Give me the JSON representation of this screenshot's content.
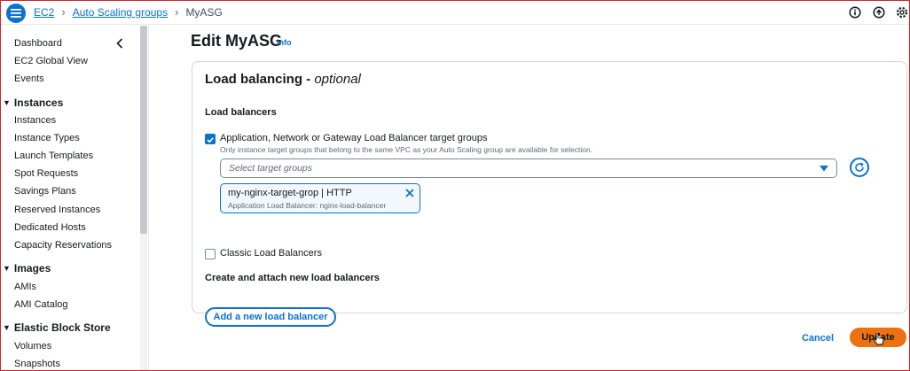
{
  "breadcrumb": {
    "items": [
      "EC2",
      "Auto Scaling groups"
    ],
    "current": "MyASG"
  },
  "topbar": {
    "icons": [
      "info-icon",
      "notifications-icon",
      "settings-icon"
    ]
  },
  "sidebar": {
    "top_items": [
      "Dashboard",
      "EC2 Global View",
      "Events"
    ],
    "sections": [
      {
        "title": "Instances",
        "items": [
          "Instances",
          "Instance Types",
          "Launch Templates",
          "Spot Requests",
          "Savings Plans",
          "Reserved Instances",
          "Dedicated Hosts",
          "Capacity Reservations"
        ]
      },
      {
        "title": "Images",
        "items": [
          "AMIs",
          "AMI Catalog"
        ]
      },
      {
        "title": "Elastic Block Store",
        "items": [
          "Volumes",
          "Snapshots"
        ]
      }
    ]
  },
  "main": {
    "title": "Edit MyASG",
    "info": "Info",
    "card": {
      "title_prefix": "Load balancing - ",
      "title_suffix": "optional",
      "lb_label": "Load balancers",
      "option_alb": {
        "label": "Application, Network or Gateway Load Balancer target groups",
        "hint": "Only instance target groups that belong to the same VPC as your Auto Scaling group are available for selection.",
        "checked": true
      },
      "select_placeholder": "Select target groups",
      "token": {
        "title": "my-nginx-target-grop | HTTP",
        "subtitle": "Application Load Balancer: nginx-load-balancer"
      },
      "option_classic": {
        "label": "Classic Load Balancers",
        "checked": false
      },
      "create_label": "Create and attach new load balancers",
      "add_button": "Add a new load balancer"
    },
    "cancel": "Cancel",
    "update": "Update"
  },
  "colors": {
    "accent": "#0972d3",
    "primary_button": "#ec7211"
  }
}
